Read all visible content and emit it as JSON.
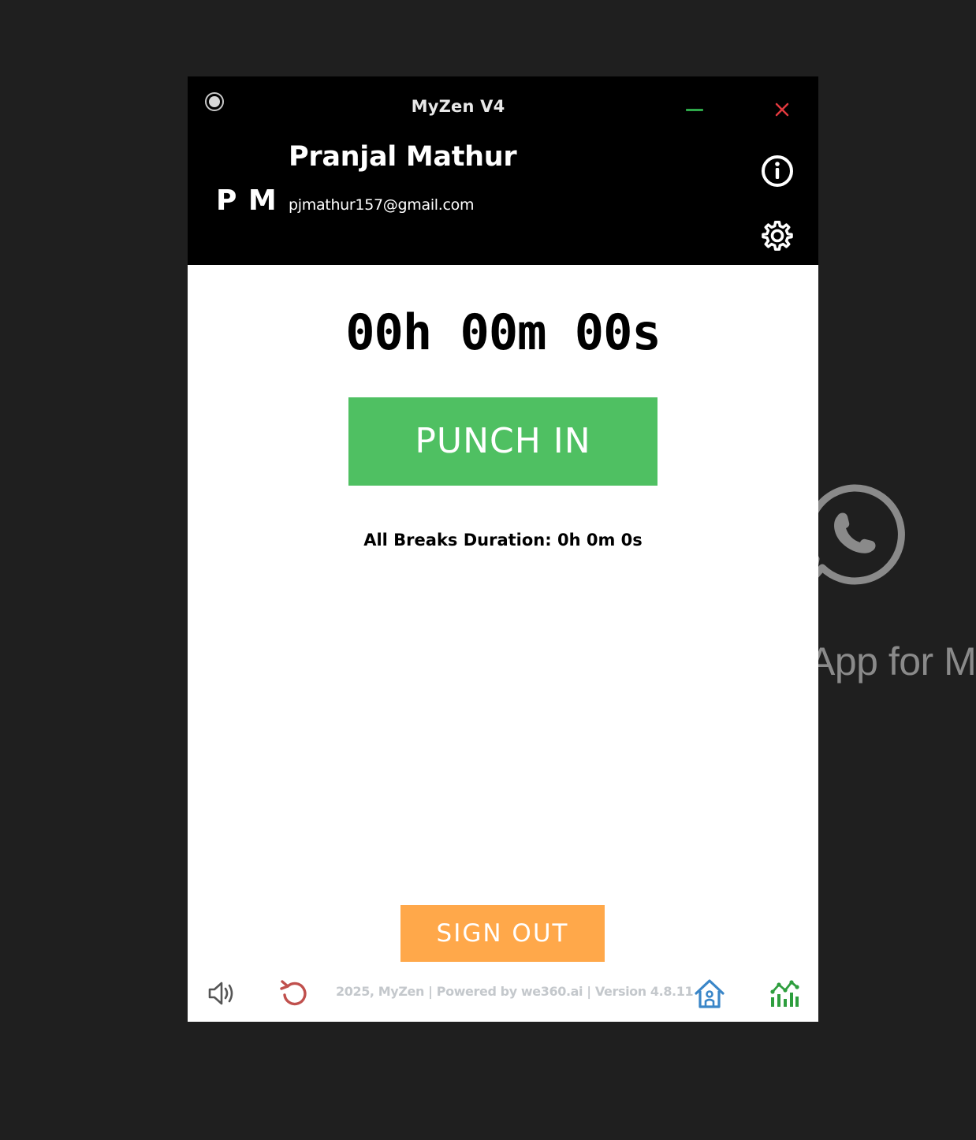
{
  "background": {
    "app_text": "App for M",
    "whatsapp_icon": "whatsapp-icon"
  },
  "window": {
    "title": "MyZen V4",
    "record_icon": "record-icon",
    "minimize_icon": "minimize-icon",
    "close_icon": "close-icon",
    "colors": {
      "header_bg": "#000000",
      "minimize": "#2ea84a",
      "close": "#e0393e"
    }
  },
  "user": {
    "initials": "P M",
    "name": "Pranjal Mathur",
    "email": "pjmathur157@gmail.com",
    "info_icon": "info-icon",
    "settings_icon": "gear-icon"
  },
  "main": {
    "timer": "00h 00m 00s",
    "punch_label": "PUNCH IN",
    "breaks_text": "All Breaks Duration: 0h 0m 0s",
    "signout_label": "SIGN OUT",
    "colors": {
      "punch": "#4fc062",
      "signout": "#ffa84a"
    }
  },
  "footer": {
    "text": "2025, MyZen | Powered by we360.ai | Version 4.8.11",
    "volume_icon": "volume-icon",
    "reset_icon": "reset-icon",
    "home_icon": "home-icon",
    "stats_icon": "stats-icon",
    "colors": {
      "reset": "#c0504d",
      "home": "#3a86c8",
      "stats": "#2e9e3e"
    }
  }
}
